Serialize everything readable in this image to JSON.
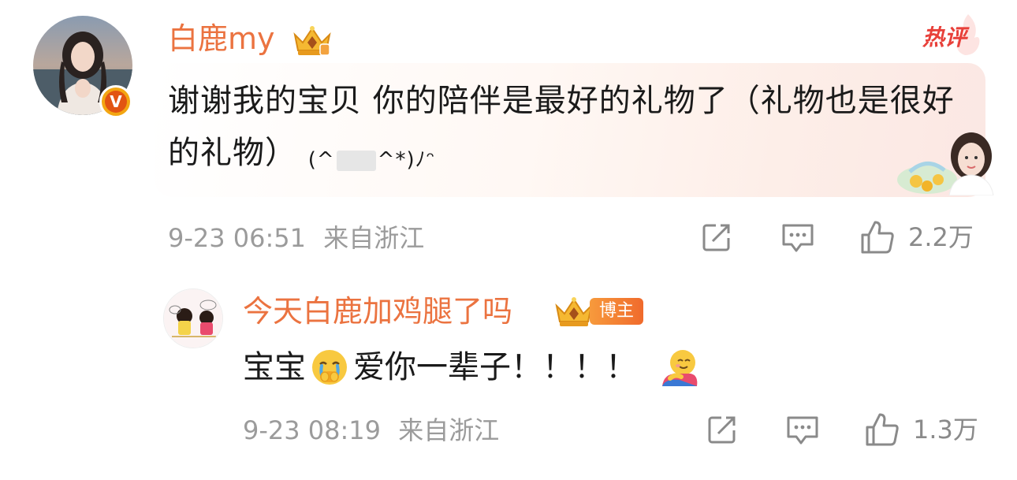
{
  "main_comment": {
    "author": "白鹿my",
    "hot_label": "热评",
    "text": "谢谢我的宝贝 你的陪伴是最好的礼物了（礼物也是很好的礼物）",
    "kaomoji_open": "(^",
    "kaomoji_close": "^*)ﾉ",
    "kaomoji_tail": "ᵔ",
    "date": "9-23 06:51",
    "source": "来自浙江",
    "like_count": "2.2万",
    "verified_mark": "V"
  },
  "reply": {
    "author": "今天白鹿加鸡腿了吗",
    "author_tag": "博主",
    "text_part1": "宝宝",
    "text_part2": "爱你一辈子！！！！",
    "date": "9-23 08:19",
    "source": "来自浙江",
    "like_count": "1.3万"
  },
  "colors": {
    "name": "#eb7340",
    "hot": "#e8403a",
    "meta": "#9b9b9b",
    "text": "#1a1a1a"
  },
  "icons": {
    "share": "share-icon",
    "comment": "comment-icon",
    "like": "like-icon",
    "crown": "crown-icon",
    "verified": "verified-icon"
  }
}
